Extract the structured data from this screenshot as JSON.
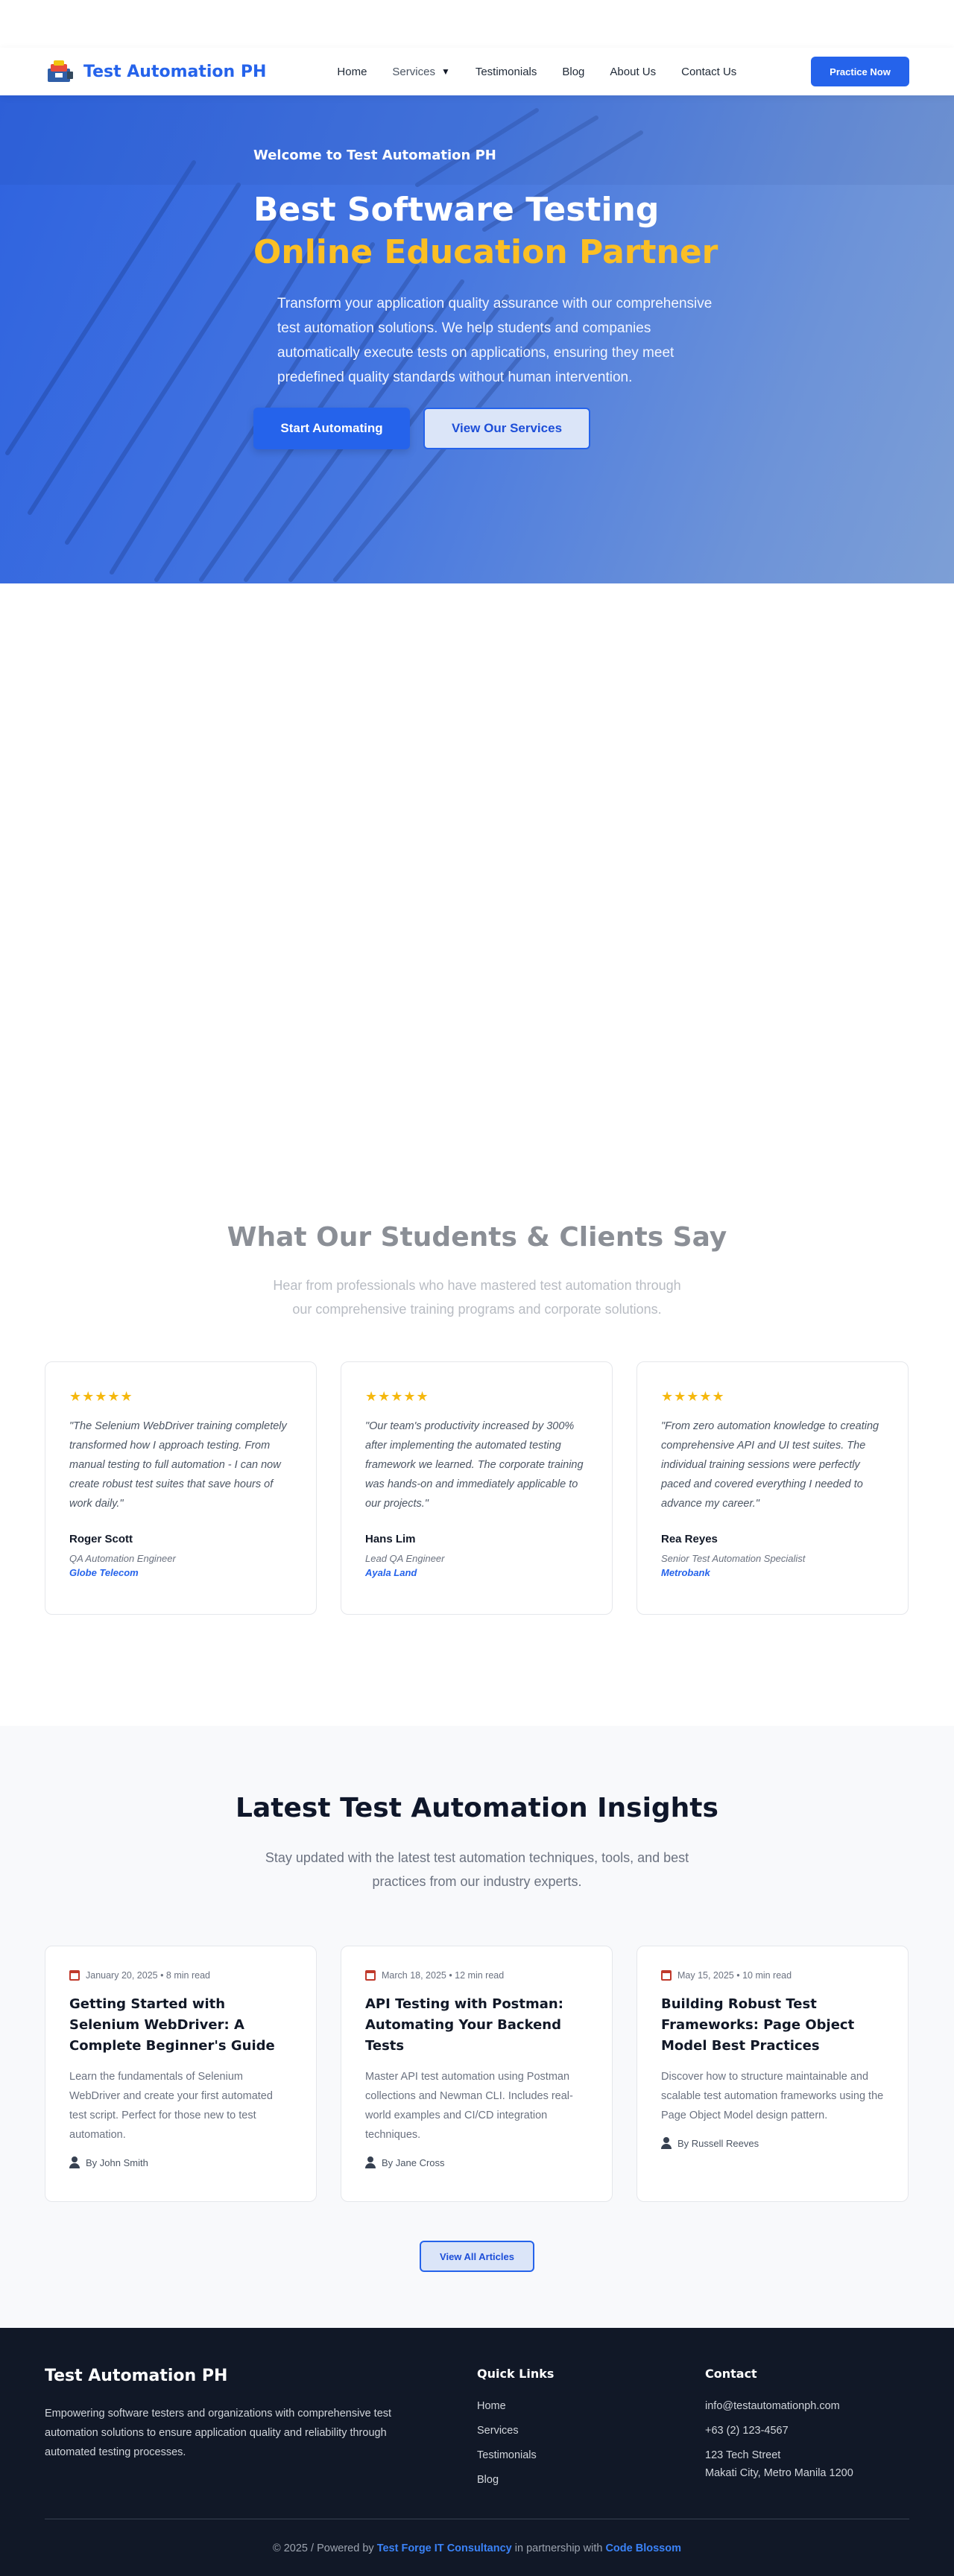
{
  "header": {
    "brand": "Test Automation PH",
    "menu": [
      "Home",
      "Services",
      "Testimonials",
      "Blog",
      "About Us",
      "Contact Us"
    ],
    "cta": "Practice Now",
    "caret": "▼"
  },
  "hero": {
    "eyebrow": "Welcome to Test Automation PH",
    "title_line1": "Best Software Testing",
    "title_line2": "Online Education Partner",
    "paragraph": "Transform your application quality assurance with our comprehensive test automation solutions. We help students and companies automatically execute tests on applications, ensuring they meet predefined quality standards without human intervention.",
    "btn_primary": "Start Automating",
    "btn_secondary": "View Our Services"
  },
  "testimonials": {
    "title": "What Our Students & Clients Say",
    "subtitle": "Hear from professionals who have mastered test automation through our comprehensive training programs and corporate solutions.",
    "items": [
      {
        "stars": "★★★★★",
        "quote": "\"The Selenium WebDriver training completely transformed how I approach testing. From manual testing to full automation - I can now create robust test suites that save hours of work daily.\"",
        "name": "Roger Scott",
        "role": "QA Automation Engineer",
        "company": "Globe Telecom"
      },
      {
        "stars": "★★★★★",
        "quote": "\"Our team's productivity increased by 300% after implementing the automated testing framework we learned. The corporate training was hands-on and immediately applicable to our projects.\"",
        "name": "Hans Lim",
        "role": "Lead QA Engineer",
        "company": "Ayala Land"
      },
      {
        "stars": "★★★★★",
        "quote": "\"From zero automation knowledge to creating comprehensive API and UI test suites. The individual training sessions were perfectly paced and covered everything I needed to advance my career.\"",
        "name": "Rea Reyes",
        "role": "Senior Test Automation Specialist",
        "company": "Metrobank"
      }
    ]
  },
  "blog": {
    "title": "Latest Test Automation Insights",
    "subtitle": "Stay updated with the latest test automation techniques, tools, and best practices from our industry experts.",
    "posts": [
      {
        "meta": "January 20, 2025 • 8 min read",
        "title": "Getting Started with Selenium WebDriver: A Complete Beginner's Guide",
        "desc": "Learn the fundamentals of Selenium WebDriver and create your first automated test script. Perfect for those new to test automation.",
        "author": "By John Smith"
      },
      {
        "meta": "March 18, 2025 • 12 min read",
        "title": "API Testing with Postman: Automating Your Backend Tests",
        "desc": "Master API test automation using Postman collections and Newman CLI. Includes real-world examples and CI/CD integration techniques.",
        "author": "By Jane Cross"
      },
      {
        "meta": "May 15, 2025 • 10 min read",
        "title": "Building Robust Test Frameworks: Page Object Model Best Practices",
        "desc": "Discover how to structure maintainable and scalable test automation frameworks using the Page Object Model design pattern.",
        "author": "By Russell Reeves"
      }
    ],
    "view_all": "View All Articles"
  },
  "footer": {
    "brand": "Test Automation PH",
    "description": "Empowering software testers and organizations with comprehensive test automation solutions to ensure application quality and reliability through automated testing processes.",
    "quick_links_title": "Quick Links",
    "quick_links": [
      "Home",
      "Services",
      "Testimonials",
      "Blog"
    ],
    "contact_title": "Contact",
    "email": "info@testautomationph.com",
    "phone": "+63 (2) 123-4567",
    "address1": "123 Tech Street",
    "address2": "Makati City, Metro Manila 1200",
    "copy_prefix": "© 2025 / Powered by",
    "copy_company": "Test Forge IT Consultancy",
    "copy_mid": "in partnership with",
    "copy_partner": "Code Blossom"
  },
  "colors": {
    "primary": "#2563eb",
    "accent_yellow": "#fbbf24",
    "footer_bg": "#111827"
  }
}
